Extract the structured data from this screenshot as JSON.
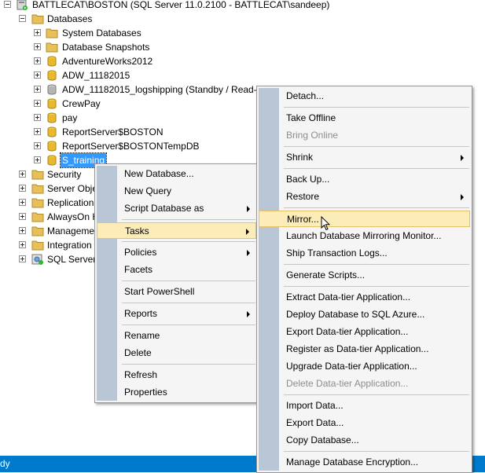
{
  "tree": {
    "server": "BATTLECAT\\BOSTON (SQL Server 11.0.2100 - BATTLECAT\\sandeep)",
    "databases_label": "Databases",
    "db_items": [
      "System Databases",
      "Database Snapshots",
      "AdventureWorks2012",
      "ADW_11182015",
      "ADW_11182015_logshipping  (Standby / Read-O",
      "CrewPay",
      "pay",
      "ReportServer$BOSTON",
      "ReportServer$BOSTONTempDB"
    ],
    "selected_db": "S_training",
    "server_nodes": [
      "Security",
      "Server Obje",
      "Replication",
      "AlwaysOn H",
      "Manageme",
      "Integration",
      "SQL Server A"
    ]
  },
  "status": {
    "text": "dy"
  },
  "context_menu": {
    "items": [
      {
        "label": "New Database..."
      },
      {
        "label": "New Query"
      },
      {
        "label": "Script Database as"
      },
      {
        "label": "Tasks"
      },
      {
        "label": "Policies"
      },
      {
        "label": "Facets"
      },
      {
        "label": "Start PowerShell"
      },
      {
        "label": "Reports"
      },
      {
        "label": "Rename"
      },
      {
        "label": "Delete"
      },
      {
        "label": "Refresh"
      },
      {
        "label": "Properties"
      }
    ]
  },
  "tasks_menu": {
    "items": [
      {
        "label": "Detach..."
      },
      {
        "label": "Take Offline"
      },
      {
        "label": "Bring Online"
      },
      {
        "label": "Shrink"
      },
      {
        "label": "Back Up..."
      },
      {
        "label": "Restore"
      },
      {
        "label": "Mirror..."
      },
      {
        "label": "Launch Database Mirroring Monitor..."
      },
      {
        "label": "Ship Transaction Logs..."
      },
      {
        "label": "Generate Scripts..."
      },
      {
        "label": "Extract Data-tier Application..."
      },
      {
        "label": "Deploy Database to SQL Azure..."
      },
      {
        "label": "Export Data-tier Application..."
      },
      {
        "label": "Register as Data-tier Application..."
      },
      {
        "label": "Upgrade Data-tier Application..."
      },
      {
        "label": "Delete Data-tier Application..."
      },
      {
        "label": "Import Data..."
      },
      {
        "label": "Export Data..."
      },
      {
        "label": "Copy Database..."
      },
      {
        "label": "Manage Database Encryption..."
      }
    ]
  },
  "colors": {
    "menu_bg": "#f5f5f5",
    "gutter": "#b9c6d5",
    "highlight": "#fcecb8",
    "selection": "#3399ff",
    "status_bar": "#007acc"
  }
}
